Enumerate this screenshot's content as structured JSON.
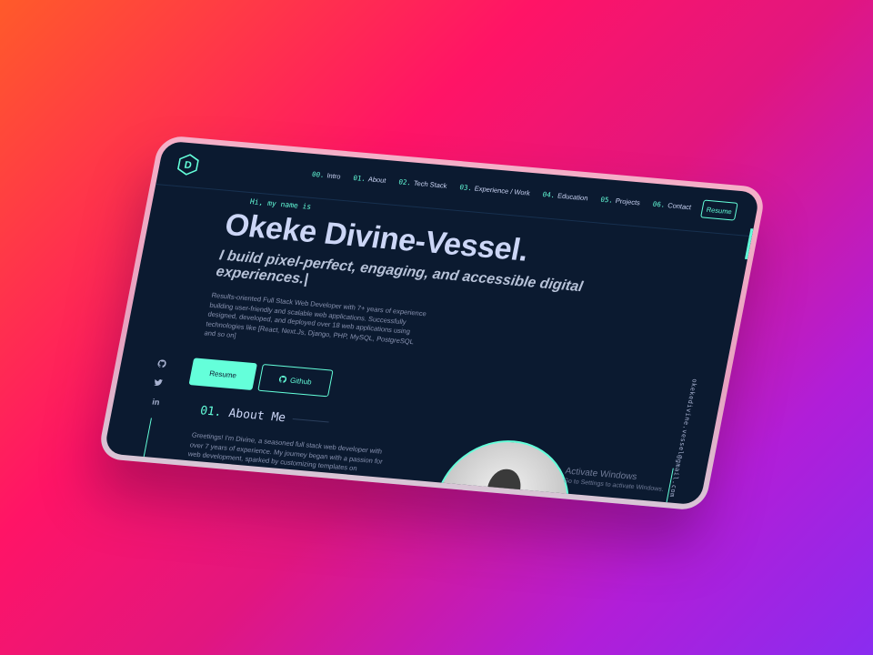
{
  "nav": {
    "items": [
      {
        "num": "00.",
        "label": "Intro"
      },
      {
        "num": "01.",
        "label": "About"
      },
      {
        "num": "02.",
        "label": "Tech Stack"
      },
      {
        "num": "03.",
        "label": "Experience / Work"
      },
      {
        "num": "04.",
        "label": "Education"
      },
      {
        "num": "05.",
        "label": "Projects"
      },
      {
        "num": "06.",
        "label": "Contact"
      }
    ],
    "resume_label": "Resume",
    "logo_letter": "D"
  },
  "hero": {
    "greeting": "Hi, my name is",
    "name": "Okeke Divine-Vessel.",
    "tagline": "I build pixel-perfect, engaging, and accessible digital experiences.|",
    "intro": "Results-oriented Full Stack Web Developer with 7+ years of experience building user-friendly and scalable web applications. Successfully designed, developed, and deployed over 18 web applications using technologies like [React, Next.Js, Django, PHP, MySQL, PostgreSQL and so on]",
    "resume_button": "Resume",
    "github_button": "Github"
  },
  "about": {
    "num": "01.",
    "title": "About Me",
    "text": "Greetings! I'm Divine, a seasoned full stack web developer with over 7 years of experience. My journey began with a passion for web development, sparked by customizing templates on CodePen."
  },
  "sidebar": {
    "email": "okekedivine.vessel@gmail.com",
    "socials": [
      "github-icon",
      "twitter-icon",
      "linkedin-icon"
    ],
    "linkedin_text": "in"
  },
  "watermark": {
    "title": "Activate Windows",
    "subtitle": "Go to Settings to activate Windows."
  },
  "colors": {
    "accent": "#64ffda",
    "background": "#0b1a30",
    "text": "#ccd6f6",
    "muted": "#8892b0"
  }
}
